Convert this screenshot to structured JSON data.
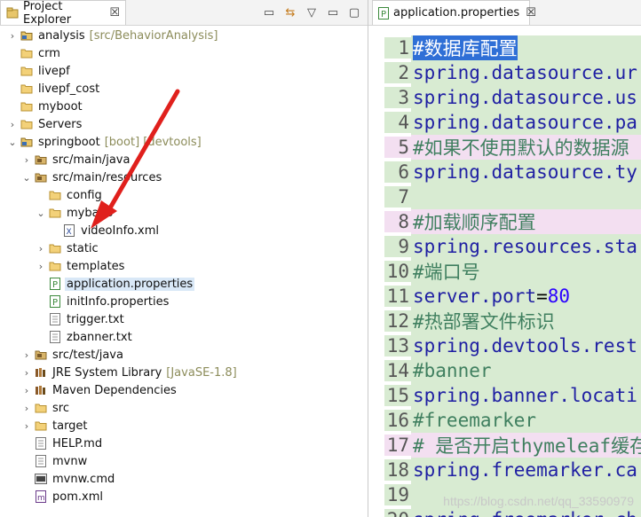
{
  "explorer": {
    "tab_title": "Project Explorer",
    "tab_close": "☒",
    "items": [
      {
        "label": "analysis",
        "deco": "[src/BehaviorAnalysis]",
        "indent": 0,
        "chev": "›",
        "icon": "project-icon"
      },
      {
        "label": "crm",
        "deco": "",
        "indent": 0,
        "chev": "",
        "icon": "folder-icon"
      },
      {
        "label": "livepf",
        "deco": "",
        "indent": 0,
        "chev": "",
        "icon": "folder-icon"
      },
      {
        "label": "livepf_cost",
        "deco": "",
        "indent": 0,
        "chev": "",
        "icon": "folder-icon"
      },
      {
        "label": "myboot",
        "deco": "",
        "indent": 0,
        "chev": "",
        "icon": "folder-icon"
      },
      {
        "label": "Servers",
        "deco": "",
        "indent": 0,
        "chev": "›",
        "icon": "folder-icon"
      },
      {
        "label": "springboot",
        "deco": "[boot] [devtools]",
        "indent": 0,
        "chev": "⌄",
        "icon": "project-icon"
      },
      {
        "label": "src/main/java",
        "deco": "",
        "indent": 1,
        "chev": "›",
        "icon": "package-folder-icon"
      },
      {
        "label": "src/main/resources",
        "deco": "",
        "indent": 1,
        "chev": "⌄",
        "icon": "package-folder-icon"
      },
      {
        "label": "config",
        "deco": "",
        "indent": 2,
        "chev": "",
        "icon": "folder-icon"
      },
      {
        "label": "mybatis",
        "deco": "",
        "indent": 2,
        "chev": "⌄",
        "icon": "folder-icon"
      },
      {
        "label": "videoInfo.xml",
        "deco": "",
        "indent": 3,
        "chev": "",
        "icon": "xml-file-icon"
      },
      {
        "label": "static",
        "deco": "",
        "indent": 2,
        "chev": "›",
        "icon": "folder-icon"
      },
      {
        "label": "templates",
        "deco": "",
        "indent": 2,
        "chev": "›",
        "icon": "folder-icon"
      },
      {
        "label": "application.properties",
        "deco": "",
        "indent": 2,
        "chev": "",
        "icon": "properties-file-icon",
        "selected": true
      },
      {
        "label": "initInfo.properties",
        "deco": "",
        "indent": 2,
        "chev": "",
        "icon": "properties-file-icon"
      },
      {
        "label": "trigger.txt",
        "deco": "",
        "indent": 2,
        "chev": "",
        "icon": "text-file-icon"
      },
      {
        "label": "zbanner.txt",
        "deco": "",
        "indent": 2,
        "chev": "",
        "icon": "text-file-icon"
      },
      {
        "label": "src/test/java",
        "deco": "",
        "indent": 1,
        "chev": "›",
        "icon": "package-folder-icon"
      },
      {
        "label": "JRE System Library",
        "deco": "[JavaSE-1.8]",
        "indent": 1,
        "chev": "›",
        "icon": "library-icon"
      },
      {
        "label": "Maven Dependencies",
        "deco": "",
        "indent": 1,
        "chev": "›",
        "icon": "library-icon"
      },
      {
        "label": "src",
        "deco": "",
        "indent": 1,
        "chev": "›",
        "icon": "folder-icon"
      },
      {
        "label": "target",
        "deco": "",
        "indent": 1,
        "chev": "›",
        "icon": "folder-icon"
      },
      {
        "label": "HELP.md",
        "deco": "",
        "indent": 1,
        "chev": "",
        "icon": "text-file-icon"
      },
      {
        "label": "mvnw",
        "deco": "",
        "indent": 1,
        "chev": "",
        "icon": "text-file-icon"
      },
      {
        "label": "mvnw.cmd",
        "deco": "",
        "indent": 1,
        "chev": "",
        "icon": "cmd-file-icon"
      },
      {
        "label": "pom.xml",
        "deco": "",
        "indent": 1,
        "chev": "",
        "icon": "maven-file-icon"
      }
    ]
  },
  "editor": {
    "tab_title": "application.properties",
    "tab_close": "☒",
    "lines": [
      {
        "n": "1",
        "parts": [
          {
            "t": "#数据库配置",
            "c": "sel"
          }
        ],
        "style": "green"
      },
      {
        "n": "2",
        "parts": [
          {
            "t": "spring.datasource.ur",
            "c": "key"
          }
        ],
        "style": "green"
      },
      {
        "n": "3",
        "parts": [
          {
            "t": "spring.datasource.us",
            "c": "key"
          }
        ],
        "style": "green"
      },
      {
        "n": "4",
        "parts": [
          {
            "t": "spring.datasource.pa",
            "c": "key"
          }
        ],
        "style": "green"
      },
      {
        "n": "5",
        "parts": [
          {
            "t": "#如果不使用默认的数据源 （co",
            "c": "comment"
          }
        ],
        "style": "pink"
      },
      {
        "n": "6",
        "parts": [
          {
            "t": "spring.datasource.ty",
            "c": "key"
          }
        ],
        "style": "green"
      },
      {
        "n": "7",
        "parts": [
          {
            "t": "",
            "c": "key"
          }
        ],
        "style": "green"
      },
      {
        "n": "8",
        "parts": [
          {
            "t": "#加载顺序配置",
            "c": "comment"
          }
        ],
        "style": "pink"
      },
      {
        "n": "9",
        "parts": [
          {
            "t": "spring.resources.sta",
            "c": "key"
          }
        ],
        "style": "green"
      },
      {
        "n": "10",
        "parts": [
          {
            "t": "#端口号",
            "c": "comment"
          }
        ],
        "style": "green"
      },
      {
        "n": "11",
        "parts": [
          {
            "t": "server.port",
            "c": "key"
          },
          {
            "t": "=",
            "c": "eq"
          },
          {
            "t": "80",
            "c": "val"
          }
        ],
        "style": "green"
      },
      {
        "n": "12",
        "parts": [
          {
            "t": "#热部署文件标识",
            "c": "comment"
          }
        ],
        "style": "green"
      },
      {
        "n": "13",
        "parts": [
          {
            "t": "spring.devtools.rest",
            "c": "key"
          }
        ],
        "style": "green"
      },
      {
        "n": "14",
        "parts": [
          {
            "t": "#banner",
            "c": "comment"
          }
        ],
        "style": "green"
      },
      {
        "n": "15",
        "parts": [
          {
            "t": "spring.banner.locati",
            "c": "key"
          }
        ],
        "style": "green"
      },
      {
        "n": "16",
        "parts": [
          {
            "t": "#freemarker",
            "c": "comment"
          }
        ],
        "style": "green"
      },
      {
        "n": "17",
        "parts": [
          {
            "t": "# 是否开启thymeleaf缓存,本",
            "c": "comment"
          }
        ],
        "style": "pink"
      },
      {
        "n": "18",
        "parts": [
          {
            "t": "spring.freemarker.ca",
            "c": "key"
          }
        ],
        "style": "green"
      },
      {
        "n": "19",
        "parts": [
          {
            "t": "",
            "c": "key"
          }
        ],
        "style": "green"
      },
      {
        "n": "20",
        "parts": [
          {
            "t": "spring.freemarker.ch",
            "c": "key"
          }
        ],
        "style": "green"
      }
    ],
    "watermark": "https://blog.csdn.net/qq_33590979"
  }
}
